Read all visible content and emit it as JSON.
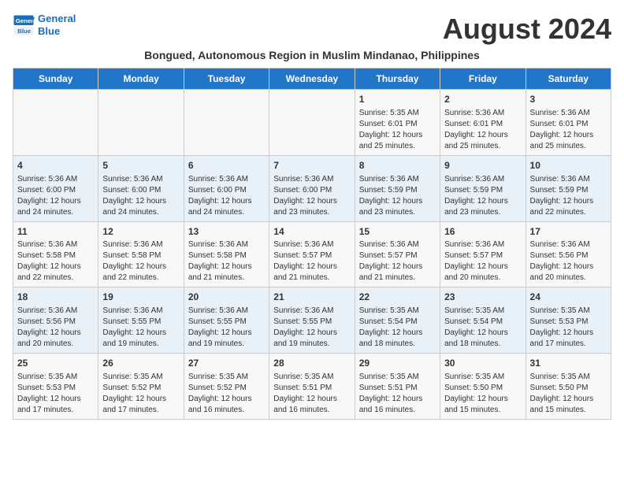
{
  "header": {
    "logo_line1": "General",
    "logo_line2": "Blue",
    "title": "August 2024",
    "subtitle": "Bongued, Autonomous Region in Muslim Mindanao, Philippines"
  },
  "weekdays": [
    "Sunday",
    "Monday",
    "Tuesday",
    "Wednesday",
    "Thursday",
    "Friday",
    "Saturday"
  ],
  "weeks": [
    [
      {
        "day": "",
        "info": ""
      },
      {
        "day": "",
        "info": ""
      },
      {
        "day": "",
        "info": ""
      },
      {
        "day": "",
        "info": ""
      },
      {
        "day": "1",
        "info": "Sunrise: 5:35 AM\nSunset: 6:01 PM\nDaylight: 12 hours\nand 25 minutes."
      },
      {
        "day": "2",
        "info": "Sunrise: 5:36 AM\nSunset: 6:01 PM\nDaylight: 12 hours\nand 25 minutes."
      },
      {
        "day": "3",
        "info": "Sunrise: 5:36 AM\nSunset: 6:01 PM\nDaylight: 12 hours\nand 25 minutes."
      }
    ],
    [
      {
        "day": "4",
        "info": "Sunrise: 5:36 AM\nSunset: 6:00 PM\nDaylight: 12 hours\nand 24 minutes."
      },
      {
        "day": "5",
        "info": "Sunrise: 5:36 AM\nSunset: 6:00 PM\nDaylight: 12 hours\nand 24 minutes."
      },
      {
        "day": "6",
        "info": "Sunrise: 5:36 AM\nSunset: 6:00 PM\nDaylight: 12 hours\nand 24 minutes."
      },
      {
        "day": "7",
        "info": "Sunrise: 5:36 AM\nSunset: 6:00 PM\nDaylight: 12 hours\nand 23 minutes."
      },
      {
        "day": "8",
        "info": "Sunrise: 5:36 AM\nSunset: 5:59 PM\nDaylight: 12 hours\nand 23 minutes."
      },
      {
        "day": "9",
        "info": "Sunrise: 5:36 AM\nSunset: 5:59 PM\nDaylight: 12 hours\nand 23 minutes."
      },
      {
        "day": "10",
        "info": "Sunrise: 5:36 AM\nSunset: 5:59 PM\nDaylight: 12 hours\nand 22 minutes."
      }
    ],
    [
      {
        "day": "11",
        "info": "Sunrise: 5:36 AM\nSunset: 5:58 PM\nDaylight: 12 hours\nand 22 minutes."
      },
      {
        "day": "12",
        "info": "Sunrise: 5:36 AM\nSunset: 5:58 PM\nDaylight: 12 hours\nand 22 minutes."
      },
      {
        "day": "13",
        "info": "Sunrise: 5:36 AM\nSunset: 5:58 PM\nDaylight: 12 hours\nand 21 minutes."
      },
      {
        "day": "14",
        "info": "Sunrise: 5:36 AM\nSunset: 5:57 PM\nDaylight: 12 hours\nand 21 minutes."
      },
      {
        "day": "15",
        "info": "Sunrise: 5:36 AM\nSunset: 5:57 PM\nDaylight: 12 hours\nand 21 minutes."
      },
      {
        "day": "16",
        "info": "Sunrise: 5:36 AM\nSunset: 5:57 PM\nDaylight: 12 hours\nand 20 minutes."
      },
      {
        "day": "17",
        "info": "Sunrise: 5:36 AM\nSunset: 5:56 PM\nDaylight: 12 hours\nand 20 minutes."
      }
    ],
    [
      {
        "day": "18",
        "info": "Sunrise: 5:36 AM\nSunset: 5:56 PM\nDaylight: 12 hours\nand 20 minutes."
      },
      {
        "day": "19",
        "info": "Sunrise: 5:36 AM\nSunset: 5:55 PM\nDaylight: 12 hours\nand 19 minutes."
      },
      {
        "day": "20",
        "info": "Sunrise: 5:36 AM\nSunset: 5:55 PM\nDaylight: 12 hours\nand 19 minutes."
      },
      {
        "day": "21",
        "info": "Sunrise: 5:36 AM\nSunset: 5:55 PM\nDaylight: 12 hours\nand 19 minutes."
      },
      {
        "day": "22",
        "info": "Sunrise: 5:35 AM\nSunset: 5:54 PM\nDaylight: 12 hours\nand 18 minutes."
      },
      {
        "day": "23",
        "info": "Sunrise: 5:35 AM\nSunset: 5:54 PM\nDaylight: 12 hours\nand 18 minutes."
      },
      {
        "day": "24",
        "info": "Sunrise: 5:35 AM\nSunset: 5:53 PM\nDaylight: 12 hours\nand 17 minutes."
      }
    ],
    [
      {
        "day": "25",
        "info": "Sunrise: 5:35 AM\nSunset: 5:53 PM\nDaylight: 12 hours\nand 17 minutes."
      },
      {
        "day": "26",
        "info": "Sunrise: 5:35 AM\nSunset: 5:52 PM\nDaylight: 12 hours\nand 17 minutes."
      },
      {
        "day": "27",
        "info": "Sunrise: 5:35 AM\nSunset: 5:52 PM\nDaylight: 12 hours\nand 16 minutes."
      },
      {
        "day": "28",
        "info": "Sunrise: 5:35 AM\nSunset: 5:51 PM\nDaylight: 12 hours\nand 16 minutes."
      },
      {
        "day": "29",
        "info": "Sunrise: 5:35 AM\nSunset: 5:51 PM\nDaylight: 12 hours\nand 16 minutes."
      },
      {
        "day": "30",
        "info": "Sunrise: 5:35 AM\nSunset: 5:50 PM\nDaylight: 12 hours\nand 15 minutes."
      },
      {
        "day": "31",
        "info": "Sunrise: 5:35 AM\nSunset: 5:50 PM\nDaylight: 12 hours\nand 15 minutes."
      }
    ]
  ]
}
